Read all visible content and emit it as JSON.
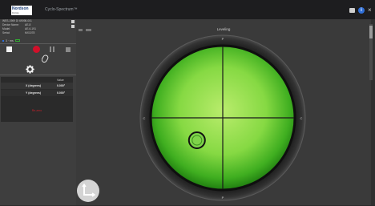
{
  "header": {
    "logo_text": "Nordson",
    "logo_sub": "DAGE",
    "app_title": "Cyclo-Spectrum™"
  },
  "device": {
    "lines": [
      {
        "key": "WES-1969 DI 69098-001",
        "value": ""
      },
      {
        "key": "Device Name:",
        "value": "AE-8"
      },
      {
        "key": "Model:",
        "value": "AE-6-191"
      },
      {
        "key": "Serial:",
        "value": "MX1078"
      }
    ],
    "status_text": "3 · ms"
  },
  "controls": {
    "stop": "stop",
    "record": "record",
    "pause": "pause",
    "square": "square"
  },
  "table": {
    "header": "Value",
    "rows": [
      {
        "label": "X (degrees)",
        "value": "0.000°"
      },
      {
        "label": "Y (degrees)",
        "value": "0.000°"
      }
    ],
    "link": "Re-zero"
  },
  "main": {
    "title": "Leveling"
  },
  "level": {
    "bubble_x_deg": -2.3,
    "bubble_y_deg": -2.0,
    "compass": {
      "top": "P",
      "bottom": "P",
      "left": "C",
      "right": "C"
    }
  },
  "colors": {
    "accent_blue": "#2f6fd8",
    "record_red": "#d2102a",
    "level_green": "#6ecf3c"
  },
  "icons": [
    "folder-icon",
    "info-icon",
    "close-icon",
    "edit-icon",
    "clip-icon",
    "gear-icon",
    "axes-icon"
  ]
}
